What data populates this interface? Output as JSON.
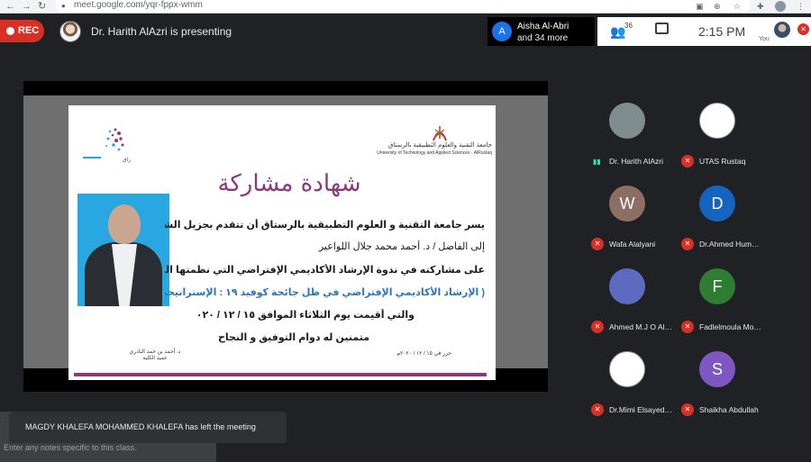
{
  "browser": {
    "url": "meet.google.com/yqr-fppx-wmm",
    "back_icon": "back-arrow-icon",
    "forward_icon": "forward-arrow-icon",
    "reload_icon": "reload-icon"
  },
  "meeting": {
    "rec_label": "REC",
    "presenter_text": "Dr. Harith AlAzri is presenting",
    "participant_first": "Aisha Al-Abri",
    "participant_more": "and 34 more",
    "aisha_initial": "A",
    "people_count": "36",
    "time": "2:15 PM",
    "self_label": "You"
  },
  "certificate": {
    "title": "شهادة مشاركة",
    "university_ar": "جامعة التقنية والعلوم التطبيقية بالرستاق",
    "university_en": "University of Technology and Applied Sciences · AlRustaq",
    "line1": "يسر جامعة التقنية و العلوم التطبيقية بالرستاق أن تتقدم بجزيل الشكر",
    "line2": "إلى الفاضل / د. أحمد محمد جلال اللواعير",
    "line3": "على مشاركته في ندوة الإرشاد الأكاديمي الإفتراضي التي نظمتها الجامعة",
    "line4": "( الإرشاد الأكاديمي الإفتراضي في ظل جائحة كوفيد ١٩ : الإستراتيجيات",
    "line5": "والتي أقيمت يوم الثلاثاء الموافق ١٥ / ١٢ / ٢٠٢٠م",
    "line6": "متمنين له دوام التوفيق و النجاح",
    "sign_name": "د. أحمد بن حمد البادري",
    "sign_title": "عميد الكلية",
    "date": "حرر في ١٥ / ١٢ / ٢٠٢٠م"
  },
  "participants": [
    {
      "name": "Dr. Harith AlAzri",
      "initial": "",
      "color": "#7f8c8d",
      "muted": false
    },
    {
      "name": "UTAS Rustaq",
      "initial": "",
      "color": "#ffffff",
      "muted": true
    },
    {
      "name": "Wafa Alalyani",
      "initial": "W",
      "color": "#8d6e63",
      "muted": true
    },
    {
      "name": "Dr.Ahmed Humaid ...",
      "initial": "D",
      "color": "#1565c0",
      "muted": true
    },
    {
      "name": "Ahmed M.J O Al Faw...",
      "initial": "",
      "color": "#5c6bc0",
      "muted": true
    },
    {
      "name": "Fadlelmoula Moha...",
      "initial": "F",
      "color": "#2e7d32",
      "muted": true
    },
    {
      "name": "Dr.Mimi Elsayed Ah...",
      "initial": "",
      "color": "#ffffff",
      "muted": true
    },
    {
      "name": "Shaikha Abdullah",
      "initial": "S",
      "color": "#7e57c2",
      "muted": true
    }
  ],
  "toast": {
    "message": "MAGDY KHALEFA MOHAMMED KHALEFA has left the meeting"
  },
  "notes": {
    "placeholder": "Enter any notes specific to this class."
  }
}
